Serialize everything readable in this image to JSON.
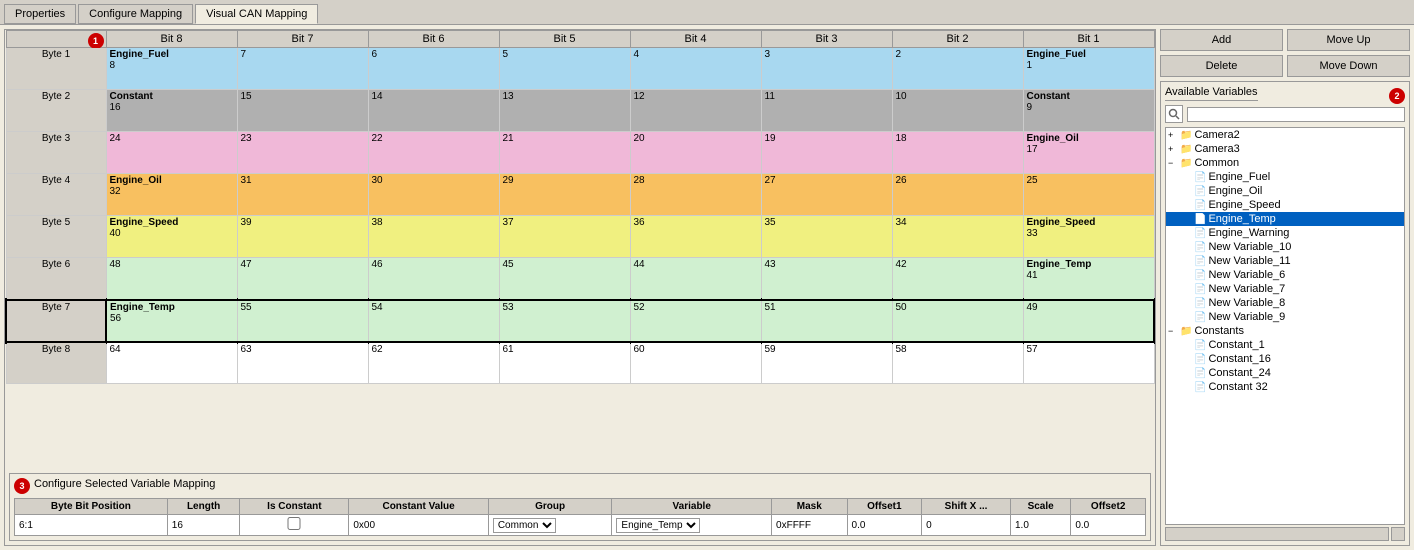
{
  "tabs": [
    {
      "label": "Properties",
      "active": false
    },
    {
      "label": "Configure Mapping",
      "active": false
    },
    {
      "label": "Visual CAN Mapping",
      "active": true
    }
  ],
  "badges": {
    "one": "1",
    "two": "2",
    "three": "3"
  },
  "buttons": {
    "add": "Add",
    "delete": "Delete",
    "move_up": "Move Up",
    "move_down": "Move Down"
  },
  "available_vars": {
    "title": "Available Variables",
    "search_placeholder": ""
  },
  "column_headers": [
    "",
    "Bit 8",
    "Bit 7",
    "Bit 6",
    "Bit 5",
    "Bit 4",
    "Bit 3",
    "Bit 2",
    "Bit 1"
  ],
  "rows": [
    {
      "label": "Byte 1",
      "color": "engine-fuel",
      "cells": [
        {
          "name": "Engine_Fuel",
          "num": "8"
        },
        {
          "name": "",
          "num": "7"
        },
        {
          "name": "",
          "num": "6"
        },
        {
          "name": "",
          "num": "5"
        },
        {
          "name": "",
          "num": "4"
        },
        {
          "name": "",
          "num": "3"
        },
        {
          "name": "",
          "num": "2"
        },
        {
          "name": "Engine_Fuel",
          "num": "1"
        }
      ]
    },
    {
      "label": "Byte 2",
      "color": "constant",
      "cells": [
        {
          "name": "Constant",
          "num": "16"
        },
        {
          "name": "",
          "num": "15"
        },
        {
          "name": "",
          "num": "14"
        },
        {
          "name": "",
          "num": "13"
        },
        {
          "name": "",
          "num": "12"
        },
        {
          "name": "",
          "num": "11"
        },
        {
          "name": "",
          "num": "10"
        },
        {
          "name": "Constant",
          "num": "9"
        }
      ]
    },
    {
      "label": "Byte 3",
      "color": "pink",
      "cells": [
        {
          "name": "",
          "num": "24"
        },
        {
          "name": "",
          "num": "23"
        },
        {
          "name": "",
          "num": "22"
        },
        {
          "name": "",
          "num": "21"
        },
        {
          "name": "",
          "num": "20"
        },
        {
          "name": "",
          "num": "19"
        },
        {
          "name": "",
          "num": "18"
        },
        {
          "name": "Engine_Oil",
          "num": "17"
        }
      ]
    },
    {
      "label": "Byte 4",
      "color": "engine-oil",
      "cells": [
        {
          "name": "Engine_Oil",
          "num": "32"
        },
        {
          "name": "",
          "num": "31"
        },
        {
          "name": "",
          "num": "30"
        },
        {
          "name": "",
          "num": "29"
        },
        {
          "name": "",
          "num": "28"
        },
        {
          "name": "",
          "num": "27"
        },
        {
          "name": "",
          "num": "26"
        },
        {
          "name": "",
          "num": "25"
        }
      ]
    },
    {
      "label": "Byte 5",
      "color": "engine-speed",
      "cells": [
        {
          "name": "Engine_Speed",
          "num": "40"
        },
        {
          "name": "",
          "num": "39"
        },
        {
          "name": "",
          "num": "38"
        },
        {
          "name": "",
          "num": "37"
        },
        {
          "name": "",
          "num": "36"
        },
        {
          "name": "",
          "num": "35"
        },
        {
          "name": "",
          "num": "34"
        },
        {
          "name": "Engine_Speed",
          "num": "33"
        }
      ]
    },
    {
      "label": "Byte 6",
      "color": "engine-temp-light",
      "cells": [
        {
          "name": "",
          "num": "48"
        },
        {
          "name": "",
          "num": "47"
        },
        {
          "name": "",
          "num": "46"
        },
        {
          "name": "",
          "num": "45"
        },
        {
          "name": "",
          "num": "44"
        },
        {
          "name": "",
          "num": "43"
        },
        {
          "name": "",
          "num": "42"
        },
        {
          "name": "Engine_Temp",
          "num": "41"
        }
      ]
    },
    {
      "label": "Byte 7",
      "color": "engine-temp",
      "selected": true,
      "cells": [
        {
          "name": "Engine_Temp",
          "num": "56"
        },
        {
          "name": "",
          "num": "55"
        },
        {
          "name": "",
          "num": "54"
        },
        {
          "name": "",
          "num": "53"
        },
        {
          "name": "",
          "num": "52"
        },
        {
          "name": "",
          "num": "51"
        },
        {
          "name": "",
          "num": "50"
        },
        {
          "name": "",
          "num": "49"
        }
      ]
    },
    {
      "label": "Byte 8",
      "color": "byte8",
      "cells": [
        {
          "name": "",
          "num": "64"
        },
        {
          "name": "",
          "num": "63"
        },
        {
          "name": "",
          "num": "62"
        },
        {
          "name": "",
          "num": "61"
        },
        {
          "name": "",
          "num": "60"
        },
        {
          "name": "",
          "num": "59"
        },
        {
          "name": "",
          "num": "58"
        },
        {
          "name": "",
          "num": "57"
        }
      ]
    }
  ],
  "configure": {
    "title": "Configure Selected Variable Mapping",
    "headers": [
      "Byte Bit Position",
      "Length",
      "Is Constant",
      "Constant Value",
      "Group",
      "Variable",
      "Mask",
      "Offset1",
      "Shift X ...",
      "Scale",
      "Offset2"
    ],
    "row": {
      "byte_bit_pos": "6:1",
      "length": "16",
      "is_constant": false,
      "constant_value": "0x00",
      "group": "Common",
      "variable": "Engine_Temp",
      "mask": "0xFFFF",
      "offset1": "0.0",
      "shift_x": "0",
      "scale": "1.0",
      "offset2": "0.0"
    }
  },
  "tree": {
    "items": [
      {
        "id": "camera2",
        "label": "Camera2",
        "type": "folder",
        "expanded": false,
        "indent": 0
      },
      {
        "id": "camera3",
        "label": "Camera3",
        "type": "folder",
        "expanded": false,
        "indent": 0
      },
      {
        "id": "common",
        "label": "Common",
        "type": "folder",
        "expanded": true,
        "indent": 0
      },
      {
        "id": "engine-fuel",
        "label": "Engine_Fuel",
        "type": "file",
        "indent": 1
      },
      {
        "id": "engine-oil",
        "label": "Engine_Oil",
        "type": "file",
        "indent": 1
      },
      {
        "id": "engine-speed",
        "label": "Engine_Speed",
        "type": "file",
        "indent": 1
      },
      {
        "id": "engine-temp",
        "label": "Engine_Temp",
        "type": "file",
        "indent": 1,
        "selected": true
      },
      {
        "id": "engine-warning",
        "label": "Engine_Warning",
        "type": "file",
        "indent": 1
      },
      {
        "id": "new-var-10",
        "label": "New Variable_10",
        "type": "file",
        "indent": 1
      },
      {
        "id": "new-var-11",
        "label": "New Variable_11",
        "type": "file",
        "indent": 1
      },
      {
        "id": "new-var-6",
        "label": "New Variable_6",
        "type": "file",
        "indent": 1
      },
      {
        "id": "new-var-7",
        "label": "New Variable_7",
        "type": "file",
        "indent": 1
      },
      {
        "id": "new-var-8",
        "label": "New Variable_8",
        "type": "file",
        "indent": 1
      },
      {
        "id": "new-var-9",
        "label": "New Variable_9",
        "type": "file",
        "indent": 1
      },
      {
        "id": "constants",
        "label": "Constants",
        "type": "folder",
        "expanded": true,
        "indent": 0
      },
      {
        "id": "constant-1",
        "label": "Constant_1",
        "type": "file",
        "indent": 1
      },
      {
        "id": "constant-16",
        "label": "Constant_16",
        "type": "file",
        "indent": 1
      },
      {
        "id": "constant-24",
        "label": "Constant_24",
        "type": "file",
        "indent": 1
      },
      {
        "id": "constant-32",
        "label": "Constant 32",
        "type": "file",
        "indent": 1
      }
    ]
  }
}
